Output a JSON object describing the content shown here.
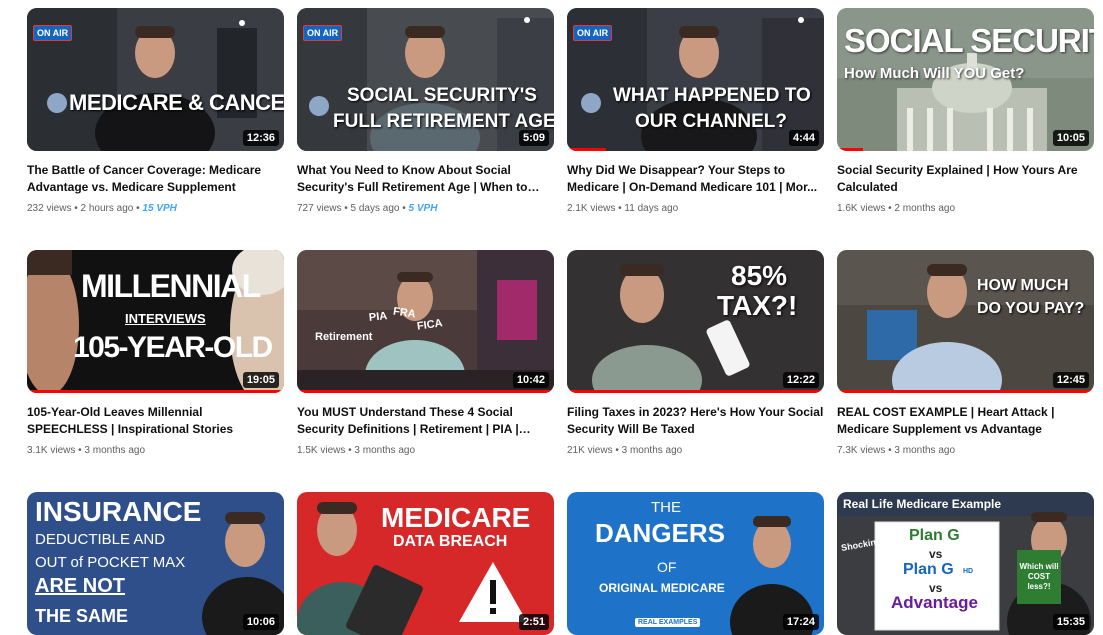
{
  "colors": {
    "accent": "#ff0000",
    "vph": "#3ea6ff",
    "meta": "#606060"
  },
  "videos": [
    {
      "thumb_text": [
        "MEDICARE & CANCER"
      ],
      "badge": "ON AIR",
      "duration": "12:36",
      "title": "The Battle of Cancer Coverage: Medicare Advantage vs. Medicare Supplement",
      "views": "232 views",
      "age": "2 hours ago",
      "vph": "15 VPH",
      "progress": 0
    },
    {
      "thumb_text": [
        "SOCIAL SECURITY'S",
        "FULL RETIREMENT AGE"
      ],
      "badge": "ON AIR",
      "duration": "5:09",
      "title": "What You Need to Know About Social Security's Full Retirement Age | When to Fil...",
      "views": "727 views",
      "age": "5 days ago",
      "vph": "5 VPH",
      "progress": 0
    },
    {
      "thumb_text": [
        "WHAT HAPPENED TO",
        "OUR CHANNEL?"
      ],
      "badge": "ON AIR",
      "duration": "4:44",
      "title": "Why Did We Disappear? Your Steps to Medicare | On-Demand Medicare 101 | Mor...",
      "views": "2.1K views",
      "age": "11 days ago",
      "vph": "",
      "progress": 0.15
    },
    {
      "thumb_text": [
        "SOCIAL SECURITY",
        "How Much Will YOU Get?"
      ],
      "duration": "10:05",
      "title": "Social Security Explained | How Yours Are Calculated",
      "views": "1.6K views",
      "age": "2 months ago",
      "vph": "",
      "progress": 0.1
    },
    {
      "thumb_text": [
        "MILLENNIAL",
        "INTERVIEWS",
        "105-YEAR-OLD"
      ],
      "duration": "19:05",
      "title": "105-Year-Old Leaves Millennial SPEECHLESS | Inspirational Stories",
      "views": "3.1K views",
      "age": "3 months ago",
      "vph": "",
      "progress": 1
    },
    {
      "thumb_text": [
        "PIA",
        "FRA",
        "FICA",
        "Retirement"
      ],
      "duration": "10:42",
      "title": "You MUST Understand These 4 Social Security Definitions | Retirement | PIA | FRA...",
      "views": "1.5K views",
      "age": "3 months ago",
      "vph": "",
      "progress": 1
    },
    {
      "thumb_text": [
        "85%",
        "TAX?!"
      ],
      "duration": "12:22",
      "title": "Filing Taxes in 2023? Here's How Your Social Security Will Be Taxed",
      "views": "21K views",
      "age": "3 months ago",
      "vph": "",
      "progress": 1
    },
    {
      "thumb_text": [
        "HOW MUCH",
        "DO YOU PAY?"
      ],
      "duration": "12:45",
      "title": "REAL COST EXAMPLE | Heart Attack | Medicare Supplement vs Advantage",
      "views": "7.3K views",
      "age": "3 months ago",
      "vph": "",
      "progress": 1
    },
    {
      "thumb_text": [
        "INSURANCE",
        "DEDUCTIBLE AND",
        "OUT of POCKET MAX",
        "ARE NOT",
        "THE SAME"
      ],
      "duration": "10:06",
      "progress": 0
    },
    {
      "thumb_text": [
        "MEDICARE",
        "DATA BREACH"
      ],
      "duration": "2:51",
      "progress": 0
    },
    {
      "thumb_text": [
        "THE",
        "DANGERS",
        "OF",
        "ORIGINAL MEDICARE",
        "REAL EXAMPLES"
      ],
      "duration": "17:24",
      "progress": 0
    },
    {
      "thumb_text": [
        "Real Life Medicare Example",
        "Plan G",
        "vs",
        "Plan G",
        "HD",
        "vs",
        "Advantage",
        "Shocking!!",
        "Which will COST less?!"
      ],
      "duration": "15:35",
      "progress": 0
    }
  ]
}
